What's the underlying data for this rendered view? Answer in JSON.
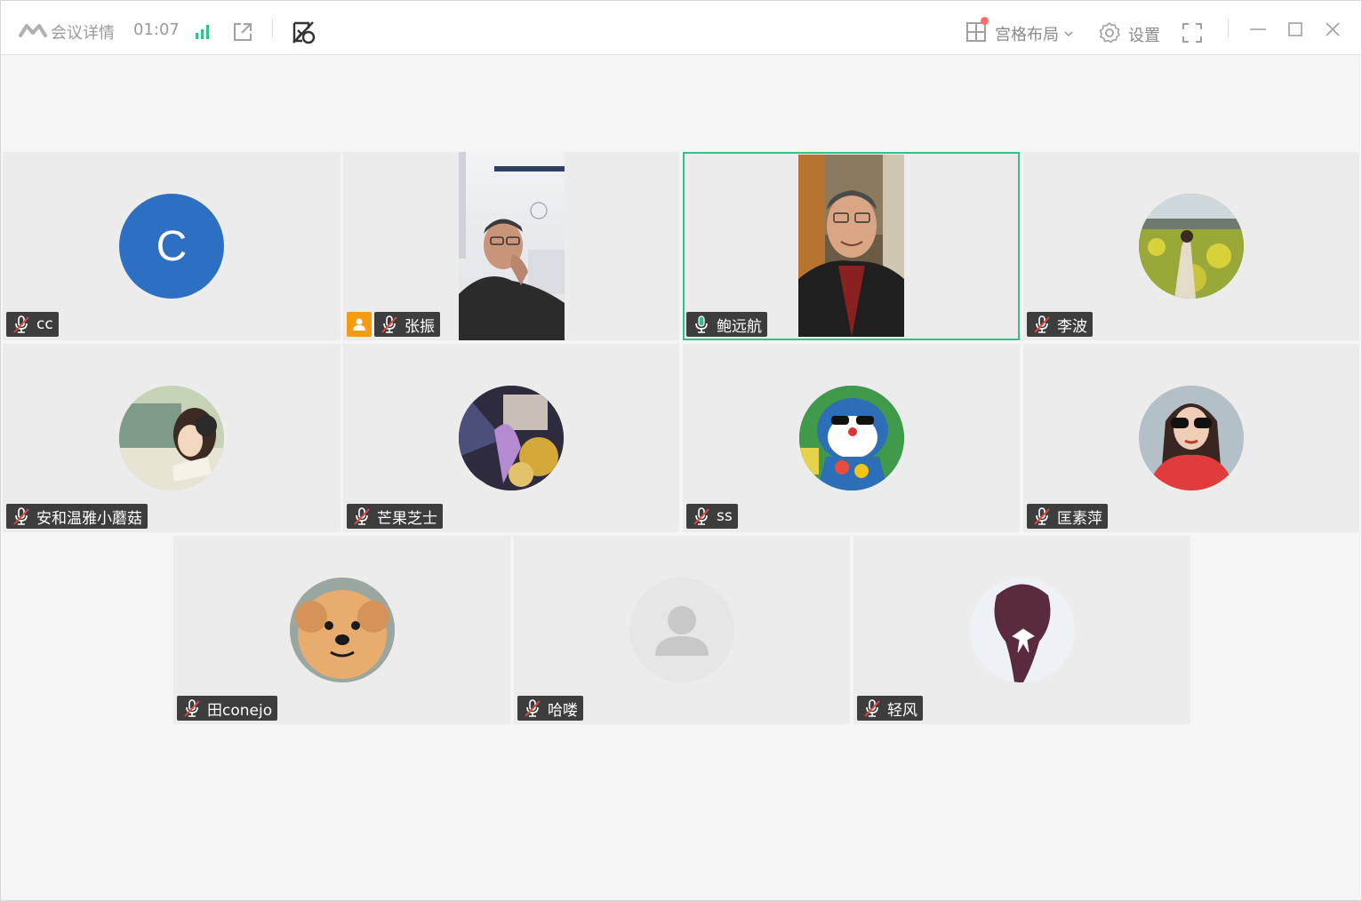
{
  "titlebar": {
    "meeting_details": "会议详情",
    "timer": "01:07",
    "layout_label": "宫格布局",
    "settings_label": "设置",
    "icons": {
      "logo": "tencent-meeting-logo-icon",
      "signal": "signal-strength-icon",
      "share": "share-external-icon",
      "whiteboard": "whiteboard-icon",
      "layout": "grid-layout-icon",
      "chevron": "chevron-down-icon",
      "settings": "gear-icon",
      "fullscreen": "fullscreen-icon",
      "minimize": "minimize-icon",
      "maximize": "maximize-icon",
      "close": "close-icon"
    }
  },
  "colors": {
    "accent_green": "#2fc28a",
    "host_badge": "#f39c12",
    "label_bg": "#3d3d3d",
    "muted_red": "#e0483e",
    "speaking_green": "#2fc28a"
  },
  "participants": [
    {
      "name": "cc",
      "mic": "muted",
      "display": "initial-avatar",
      "initial": "C"
    },
    {
      "name": "张振",
      "mic": "muted",
      "display": "video",
      "host": true
    },
    {
      "name": "鲍远航",
      "mic": "speaking",
      "display": "video",
      "active": true
    },
    {
      "name": "李波",
      "mic": "muted",
      "display": "photo-avatar"
    },
    {
      "name": "安和温雅小蘑菇",
      "mic": "muted",
      "display": "photo-avatar"
    },
    {
      "name": "芒果芝士",
      "mic": "muted",
      "display": "photo-avatar"
    },
    {
      "name": "ss",
      "mic": "muted",
      "display": "photo-avatar"
    },
    {
      "name": "匡素萍",
      "mic": "muted",
      "display": "photo-avatar"
    },
    {
      "name": "田conejo",
      "mic": "muted",
      "display": "photo-avatar"
    },
    {
      "name": "哈喽",
      "mic": "muted",
      "display": "default-avatar"
    },
    {
      "name": "轻风",
      "mic": "muted",
      "display": "photo-avatar"
    }
  ]
}
